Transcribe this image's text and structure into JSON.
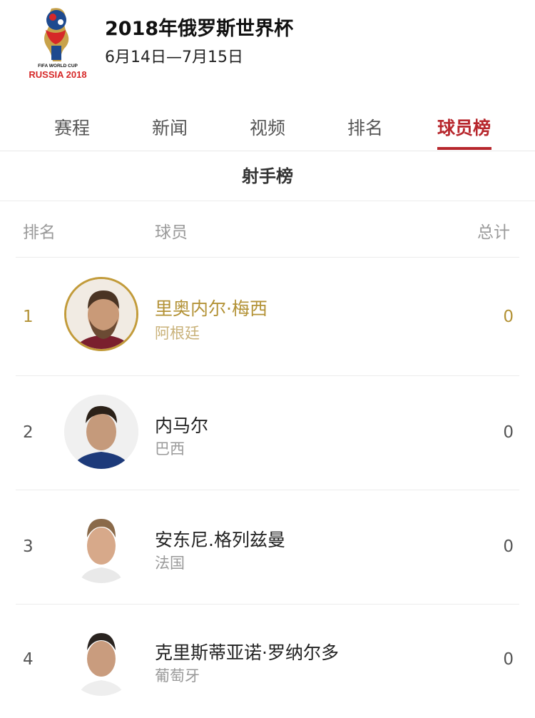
{
  "header": {
    "logo_text_top": "FIFA WORLD CUP",
    "logo_text_bottom": "RUSSIA 2018",
    "title": "2018年俄罗斯世界杯",
    "dates": "6月14日—7月15日"
  },
  "tabs": [
    {
      "label": "赛程",
      "active": false
    },
    {
      "label": "新闻",
      "active": false
    },
    {
      "label": "视频",
      "active": false
    },
    {
      "label": "排名",
      "active": false
    },
    {
      "label": "球员榜",
      "active": true
    }
  ],
  "section_title": "射手榜",
  "columns": {
    "rank": "排名",
    "player": "球员",
    "total": "总计"
  },
  "players": [
    {
      "rank": "1",
      "name": "里奥内尔·梅西",
      "country": "阿根廷",
      "total": "0"
    },
    {
      "rank": "2",
      "name": "内马尔",
      "country": "巴西",
      "total": "0"
    },
    {
      "rank": "3",
      "name": "安东尼.格列兹曼",
      "country": "法国",
      "total": "0"
    },
    {
      "rank": "4",
      "name": "克里斯蒂亚诺·罗纳尔多",
      "country": "葡萄牙",
      "total": "0"
    }
  ],
  "colors": {
    "accent": "#b7272d",
    "gold": "#b39236"
  }
}
